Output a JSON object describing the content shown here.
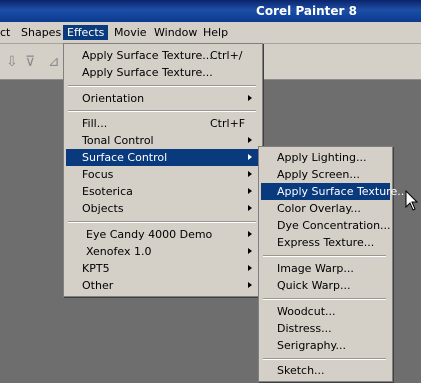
{
  "window": {
    "title": "Corel Painter 8"
  },
  "menubar": {
    "items": [
      {
        "label": "ct"
      },
      {
        "label": "Shapes"
      },
      {
        "label": "Effects"
      },
      {
        "label": "Movie"
      },
      {
        "label": "Window"
      },
      {
        "label": "Help"
      }
    ]
  },
  "effects_menu": {
    "items": [
      {
        "label": "Apply Surface Texture...",
        "shortcut": "Ctrl+/"
      },
      {
        "label": "Apply Surface Texture..."
      },
      {
        "label": "Orientation"
      },
      {
        "label": "Fill...",
        "shortcut": "Ctrl+F"
      },
      {
        "label": "Tonal Control"
      },
      {
        "label": "Surface Control"
      },
      {
        "label": "Focus"
      },
      {
        "label": "Esoterica"
      },
      {
        "label": "Objects"
      },
      {
        "label": "Eye Candy 4000 Demo"
      },
      {
        "label": "Xenofex 1.0"
      },
      {
        "label": "KPT5"
      },
      {
        "label": "Other"
      }
    ]
  },
  "surface_control_menu": {
    "items": [
      {
        "label": "Apply Lighting..."
      },
      {
        "label": "Apply Screen..."
      },
      {
        "label": "Apply Surface Texture..."
      },
      {
        "label": "Color Overlay..."
      },
      {
        "label": "Dye Concentration..."
      },
      {
        "label": "Express Texture..."
      },
      {
        "label": "Image Warp..."
      },
      {
        "label": "Quick Warp..."
      },
      {
        "label": "Woodcut..."
      },
      {
        "label": "Distress..."
      },
      {
        "label": "Serigraphy..."
      },
      {
        "label": "Sketch..."
      }
    ]
  },
  "icons": [
    "tool-arrow-down-icon",
    "tool-filter-icon",
    "tool-grayed-icon",
    "mouse-cursor-icon"
  ],
  "colors": {
    "highlight": "#0a3a7e",
    "menu_bg": "#d4d0c8",
    "workspace": "#6e6e6e"
  }
}
